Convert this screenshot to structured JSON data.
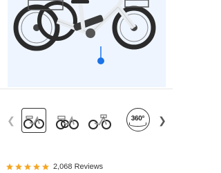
{
  "gallery": {
    "main_image_alt": "Electric tricycle, white frame, fat tires",
    "colors": {
      "hero_background": "#eef5ff",
      "frame": "#e9ecef",
      "tire": "#2b2b2b",
      "indicator": "#1a73e8"
    },
    "thumbnails": [
      {
        "label": "Front three-quarter view",
        "selected": true
      },
      {
        "label": "Side view with basket",
        "selected": false
      },
      {
        "label": "Side view",
        "selected": false
      }
    ],
    "view_360_label": "360°",
    "prev_icon": "chevron-left-icon",
    "next_icon": "chevron-right-icon"
  },
  "rating": {
    "stars": 5,
    "star_color": "#f5a623",
    "review_count_text": "2,068 Reviews"
  }
}
